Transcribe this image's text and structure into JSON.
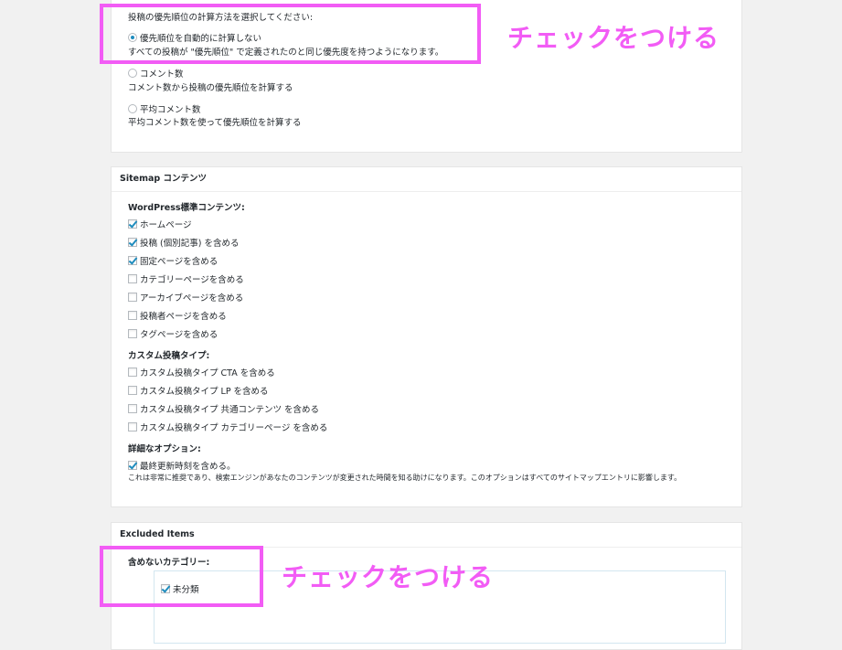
{
  "priority": {
    "prompt": "投稿の優先順位の計算方法を選択してください:",
    "options": [
      {
        "label": "優先順位を自動的に計算しない",
        "desc": "すべての投稿が \"優先順位\" で定義されたのと同じ優先度を持つようになります。",
        "selected": true
      },
      {
        "label": "コメント数",
        "desc": "コメント数から投稿の優先順位を計算する",
        "selected": false
      },
      {
        "label": "平均コメント数",
        "desc": "平均コメント数を使って優先順位を計算する",
        "selected": false
      }
    ]
  },
  "sitemap": {
    "title": "Sitemap コンテンツ",
    "standard_heading": "WordPress標準コンテンツ:",
    "standard_items": [
      {
        "label": "ホームページ",
        "checked": true
      },
      {
        "label": "投稿 (個別記事) を含める",
        "checked": true
      },
      {
        "label": "固定ページを含める",
        "checked": true
      },
      {
        "label": "カテゴリーページを含める",
        "checked": false
      },
      {
        "label": "アーカイブページを含める",
        "checked": false
      },
      {
        "label": "投稿者ページを含める",
        "checked": false
      },
      {
        "label": "タグページを含める",
        "checked": false
      }
    ],
    "custom_heading": "カスタム投稿タイプ:",
    "custom_items": [
      {
        "label": "カスタム投稿タイプ CTA を含める",
        "checked": false
      },
      {
        "label": "カスタム投稿タイプ LP を含める",
        "checked": false
      },
      {
        "label": "カスタム投稿タイプ 共通コンテンツ を含める",
        "checked": false
      },
      {
        "label": "カスタム投稿タイプ カテゴリーページ を含める",
        "checked": false
      }
    ],
    "advanced_heading": "詳細なオプション:",
    "advanced_item": {
      "label": "最終更新時刻を含める。",
      "checked": true
    },
    "advanced_note": "これは非常に推奨であり、検索エンジンがあなたのコンテンツが変更された時間を知る助けになります。このオプションはすべてのサイトマップエントリに影響します。"
  },
  "excluded": {
    "title": "Excluded Items",
    "heading": "含めないカテゴリー:",
    "categories": [
      {
        "label": "未分類",
        "checked": true
      }
    ]
  },
  "annotations": {
    "top": "チェックをつける",
    "bottom": "チェックをつける",
    "color": "#f25cf5"
  }
}
